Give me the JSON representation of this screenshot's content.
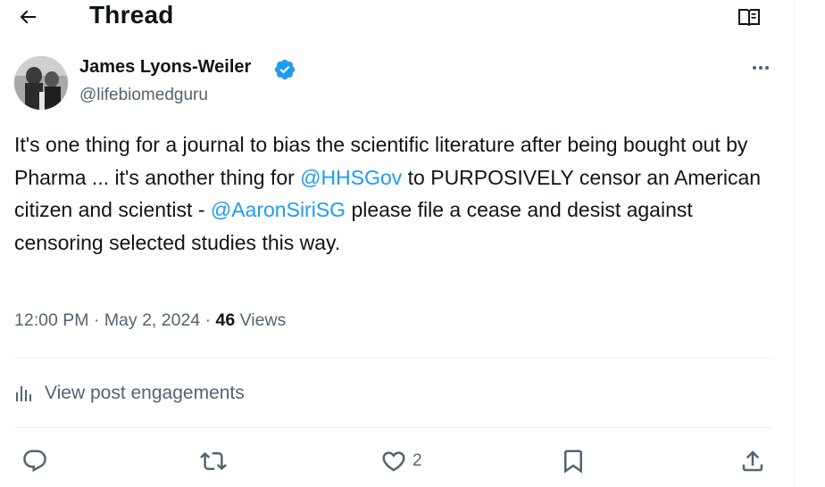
{
  "header": {
    "title": "Thread"
  },
  "author": {
    "name": "James Lyons-Weiler",
    "handle": "@lifebiomedguru"
  },
  "tweet": {
    "segment_1": "It's one thing for a journal to bias the scientific literature after being bought out by Pharma ... it's another thing for ",
    "mention_1": "@HHSGov",
    "segment_2": " to PURPOSIVELY censor an American citizen and scientist - ",
    "mention_2": "@AaronSiriSG",
    "segment_3": " please file a cease and desist against censoring selected studies this way."
  },
  "meta": {
    "time": "12:00 PM",
    "separator": "·",
    "date": "May 2, 2024",
    "views_count": "46",
    "views_label": "Views"
  },
  "engagements_link": "View post engagements",
  "actions": {
    "like_count": "2"
  },
  "icons": {
    "back": "arrow-left-icon",
    "reader": "open-book-icon",
    "verified": "verified-badge-icon",
    "more": "more-horizontal-icon",
    "analytics": "bar-chart-icon",
    "reply": "reply-bubble-icon",
    "retweet": "retweet-icon",
    "like": "heart-icon",
    "bookmark": "bookmark-icon",
    "share": "share-upload-icon"
  },
  "colors": {
    "accent": "#1d9bf0",
    "text": "#0f1419",
    "secondary": "#536471",
    "divider": "#eff3f4"
  }
}
